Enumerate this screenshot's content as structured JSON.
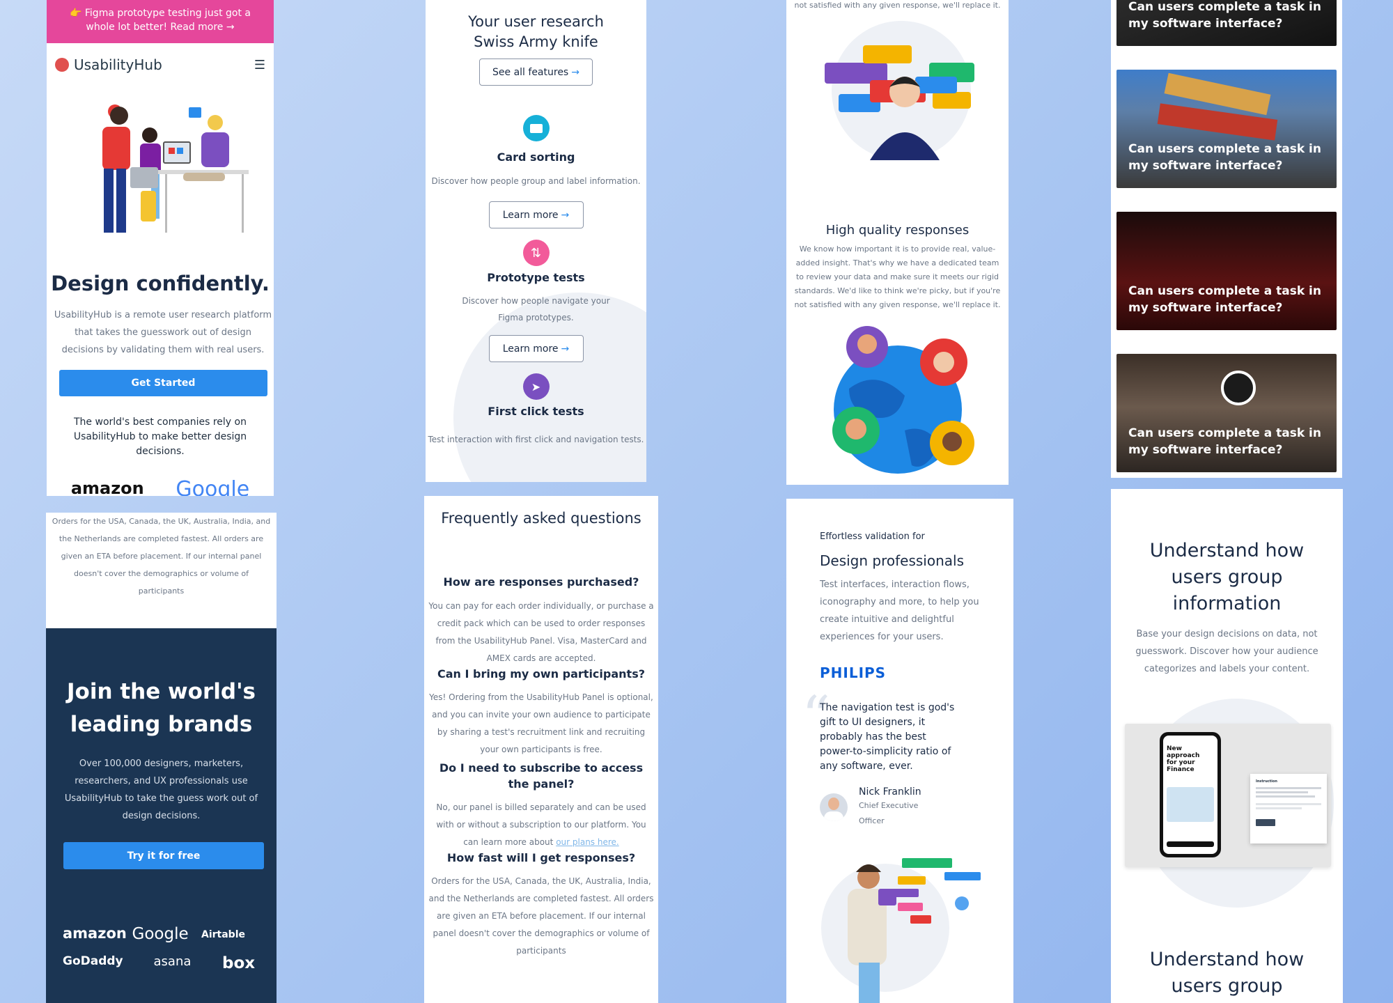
{
  "p1": {
    "banner": "👉 Figma prototype testing just got a whole lot better! Read more →",
    "logo": "UsabilityHub",
    "headline": "Design confidently.",
    "description": "UsabilityHub is a remote user research platform that takes the guesswork out of design decisions by validating them with real users.",
    "cta": "Get Started",
    "trust": "The world's best companies rely on UsabilityHub to make better design decisions.",
    "logo_amazon": "amazon",
    "logo_google": "Google"
  },
  "p2": {
    "title": "Your user research Swiss Army knife",
    "see_all": "See all features",
    "features": [
      {
        "title": "Card sorting",
        "desc": "Discover how people group and label information.",
        "btn": "Learn more",
        "color": "#16b0d8"
      },
      {
        "title": "Prototype tests",
        "desc": "Discover how people navigate your Figma prototypes.",
        "btn": "Learn more",
        "color": "#f25b9a"
      },
      {
        "title": "First click tests",
        "desc": "Test interaction with first click and navigation tests.",
        "color": "#7a4fc0"
      }
    ]
  },
  "p3": {
    "top_text": "not satisfied with any given response, we'll replace it.",
    "title": "High quality responses",
    "desc": "We know how important it is to provide real, value-added insight. That's why we have a dedicated team to review your data and make sure it meets our rigid standards. We'd like to think we're picky, but if you're not satisfied with any given response, we'll replace it."
  },
  "p4": {
    "cards": [
      "Can users complete a task in my software interface?",
      "Can users complete a task in my software interface?",
      "Can users complete a task in my software interface?",
      "Can users complete a task in my software interface?"
    ]
  },
  "p5": {
    "text": "Orders for the USA, Canada, the UK, Australia, India, and the Netherlands are completed fastest. All orders are given an ETA before placement. If our internal panel doesn't cover the demographics or volume of participants",
    "headline": "Join the world's leading brands",
    "desc": "Over 100,000 designers, marketers, researchers, and UX professionals use UsabilityHub to take the guess work out of design decisions.",
    "cta": "Try it for free",
    "logos": [
      "amazon",
      "Google",
      "Airtable",
      "GoDaddy",
      "asana",
      "box"
    ]
  },
  "p6": {
    "title": "Frequently asked questions",
    "faqs": [
      {
        "q": "How are responses purchased?",
        "a": "You can pay for each order individually, or purchase a credit pack which can be used to order responses from the UsabilityHub Panel. Visa, MasterCard and AMEX cards are accepted."
      },
      {
        "q": "Can I bring my own participants?",
        "a": "Yes! Ordering from the UsabilityHub Panel is optional, and you can invite your own audience to participate by sharing a test's recruitment link and recruiting your own participants is free."
      },
      {
        "q": "Do I need to subscribe to access the panel?",
        "a": "No, our panel is billed separately and can be used with or without a subscription to our platform. You can learn more about",
        "link": "our plans here."
      },
      {
        "q": "How fast will I get responses?",
        "a": "Orders for the USA, Canada, the UK, Australia, India, and the Netherlands are completed fastest. All orders are given an ETA before placement. If our internal panel doesn't cover the demographics or volume of participants"
      }
    ]
  },
  "p7": {
    "eyebrow": "Effortless validation for",
    "title": "Design professionals",
    "desc": "Test interfaces, interaction flows, iconography and more, to help you create intuitive and delightful experiences for your users.",
    "brand": "PHILIPS",
    "quote": "The navigation test is god's gift to UI designers, it probably has the best power-to-simplicity ratio of any software, ever.",
    "author": "Nick Franklin",
    "role": "Chief Executive Officer"
  },
  "p8": {
    "title": "Understand how users group information",
    "desc": "Base your design decisions on data, not guesswork. Discover how your audience categorizes and labels your content.",
    "phone_text": "New approach for your Finance",
    "dialog_title": "Instruction",
    "title2": "Understand how users group information"
  }
}
